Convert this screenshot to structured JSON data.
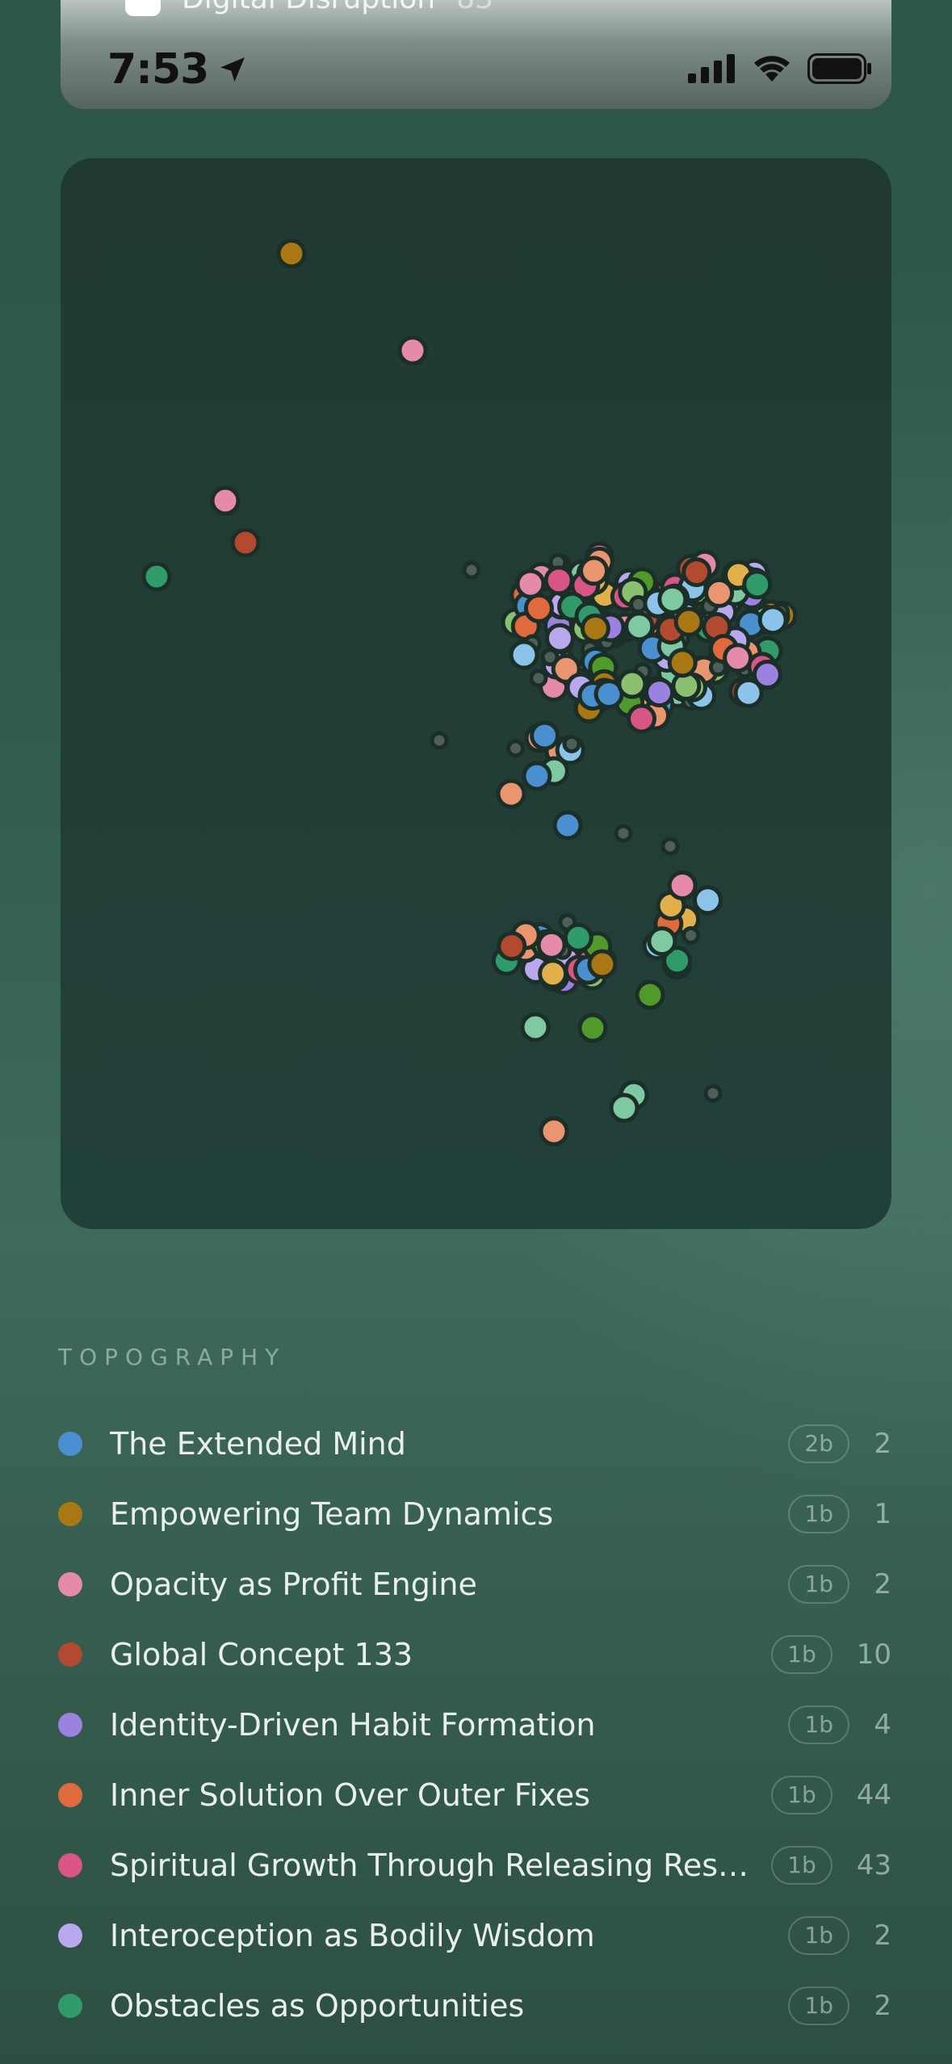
{
  "status_bar": {
    "time": "7:53",
    "peek_item": {
      "label": "Digital Disruption",
      "count": "83"
    }
  },
  "section": {
    "label": "TOPOGRAPHY"
  },
  "colors": {
    "blue": "#4a90d0",
    "amber": "#a97812",
    "pink": "#e58aa8",
    "rust": "#b14a2e",
    "violet": "#9b82e0",
    "orange": "#e06a3e",
    "magenta": "#d85585",
    "lavender": "#b9a8ee",
    "teal": "#2f9a6a",
    "sage": "#8ac070",
    "gold": "#e2b04a",
    "mint": "#7fc9a2",
    "lightblue": "#8cc3ea",
    "salmon": "#ea9570",
    "green": "#4f9a2a",
    "gray": "#4d5f58"
  },
  "topics": [
    {
      "name": "The Extended Mind",
      "badge": "2b",
      "count": "2",
      "color": "#4a90d0"
    },
    {
      "name": "Empowering Team Dynamics",
      "badge": "1b",
      "count": "1",
      "color": "#a97812"
    },
    {
      "name": "Opacity as Profit Engine",
      "badge": "1b",
      "count": "2",
      "color": "#e58aa8"
    },
    {
      "name": "Global Concept 133",
      "badge": "1b",
      "count": "10",
      "color": "#b14a2e"
    },
    {
      "name": "Identity-Driven Habit Formation",
      "badge": "1b",
      "count": "4",
      "color": "#9b82e0"
    },
    {
      "name": "Inner Solution Over Outer Fixes",
      "badge": "1b",
      "count": "44",
      "color": "#e06a3e"
    },
    {
      "name": "Spiritual Growth Through Releasing Resi...",
      "badge": "1b",
      "count": "43",
      "color": "#d85585"
    },
    {
      "name": "Interoception as Bodily Wisdom",
      "badge": "1b",
      "count": "2",
      "color": "#b9a8ee"
    },
    {
      "name": "Obstacles as Opportunities",
      "badge": "1b",
      "count": "2",
      "color": "#2f9a6a"
    }
  ]
}
